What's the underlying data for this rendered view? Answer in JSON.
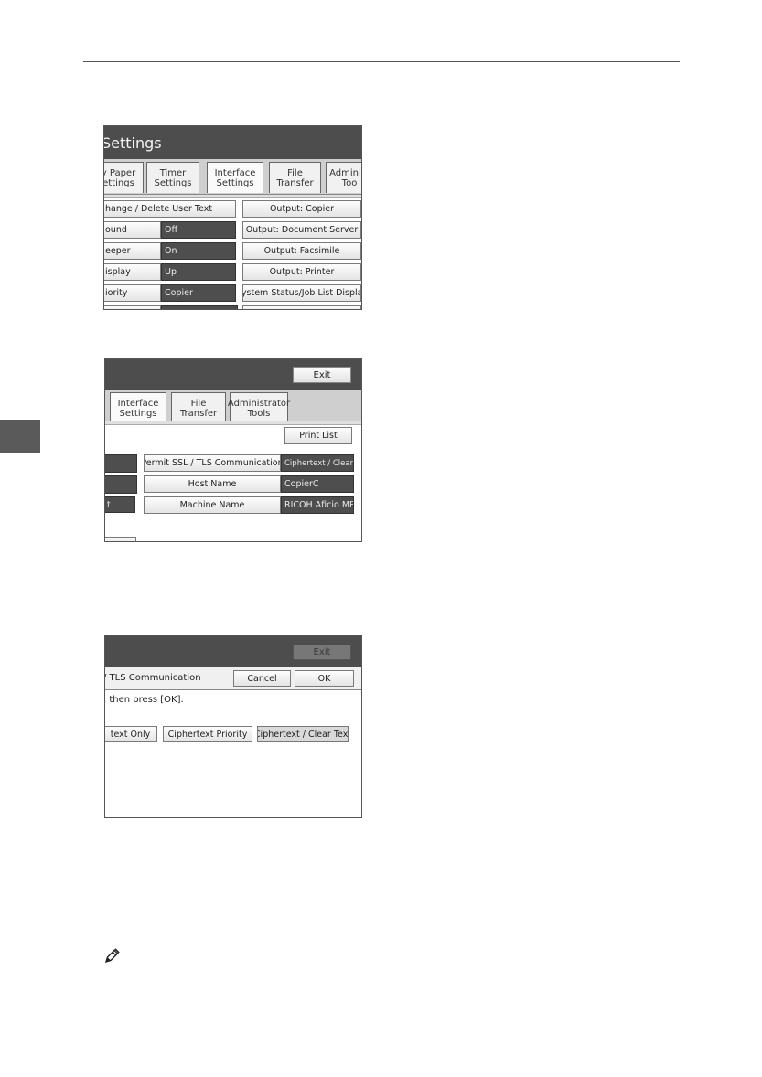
{
  "panel1": {
    "title": "Settings",
    "tabs": [
      "y Paper\nettings",
      "Timer\nSettings",
      "Interface\nSettings",
      "File\nTransfer",
      "Administ\nToo"
    ],
    "left_rows": [
      {
        "label": "hange / Delete User Text",
        "value": ""
      },
      {
        "label": "ound",
        "value": "Off"
      },
      {
        "label": "eeper",
        "value": "On"
      },
      {
        "label": "isplay",
        "value": "Up"
      },
      {
        "label": "iority",
        "value": "Copier"
      }
    ],
    "right_buttons": [
      "Output: Copier",
      "Output: Document Server",
      "Output: Facsimile",
      "Output: Printer",
      "System Status/Job List Display"
    ]
  },
  "panel2": {
    "exit_label": "Exit",
    "tabs": [
      "Interface\nSettings",
      "File\nTransfer",
      "Administrator\nTools"
    ],
    "print_list_label": "Print List",
    "rows": [
      {
        "label": "Permit SSL / TLS Communication",
        "value": "Ciphertext / Clear Text"
      },
      {
        "label": "Host Name",
        "value": "CopierC"
      },
      {
        "label": "Machine Name",
        "value": "RICOH Aficio MP"
      }
    ],
    "left_partial": "t"
  },
  "panel3": {
    "exit_label": "Exit",
    "heading": "/ TLS Communication",
    "cancel_label": "Cancel",
    "ok_label": "OK",
    "instruction": ", then press [OK].",
    "options": [
      "text Only",
      "Ciphertext Priority",
      "Ciphertext / Clear Text"
    ]
  }
}
